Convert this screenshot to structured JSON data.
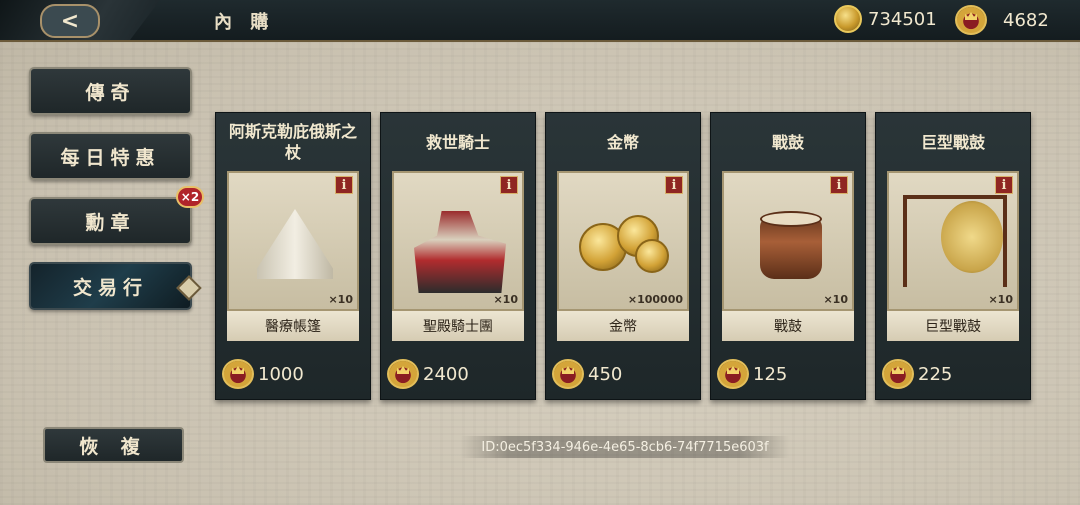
{
  "header": {
    "back_label": "<",
    "title": "內 購",
    "gold": "734501",
    "crowns": "4682"
  },
  "sidebar": {
    "items": [
      {
        "label": "傳奇"
      },
      {
        "label": "每日特惠"
      },
      {
        "label": "勳章",
        "badge": "×2"
      },
      {
        "label": "交易行"
      }
    ]
  },
  "cards": [
    {
      "title": "阿斯克勒庇俄斯之杖",
      "name": "醫療帳篷",
      "qty": "×10",
      "price": "1000"
    },
    {
      "title": "救世騎士",
      "name": "聖殿騎士團",
      "qty": "×10",
      "price": "2400"
    },
    {
      "title": "金幣",
      "name": "金幣",
      "qty": "×100000",
      "price": "450"
    },
    {
      "title": "戰鼓",
      "name": "戰鼓",
      "qty": "×10",
      "price": "125"
    },
    {
      "title": "巨型戰鼓",
      "name": "巨型戰鼓",
      "qty": "×10",
      "price": "225"
    }
  ],
  "footer": {
    "restore_label": "恢 複",
    "id_text": "ID:0ec5f334-946e-4e65-8cb6-74f7715e603f"
  },
  "icons": {
    "gold": "gold-coin-icon",
    "crown": "crown-medal-icon",
    "info": "info-icon"
  },
  "info_glyph": "i"
}
